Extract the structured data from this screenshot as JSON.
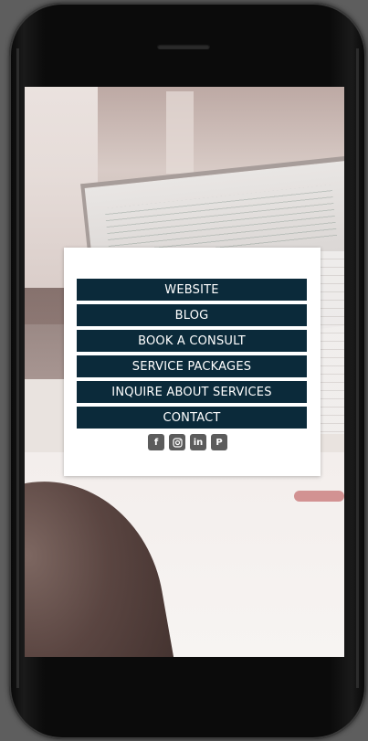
{
  "menu": {
    "items": [
      {
        "label": "WEBSITE"
      },
      {
        "label": "BLOG"
      },
      {
        "label": "BOOK A CONSULT"
      },
      {
        "label": "SERVICE PACKAGES"
      },
      {
        "label": "INQUIRE ABOUT SERVICES"
      },
      {
        "label": "CONTACT"
      }
    ]
  },
  "social": {
    "icons": [
      "facebook-icon",
      "instagram-icon",
      "linkedin-icon",
      "pinterest-icon"
    ]
  },
  "colors": {
    "menu_button": "#0b2a3a",
    "social_icon": "#5c5c5c",
    "card": "#ffffff",
    "phone_body": "#0b0b0b"
  }
}
